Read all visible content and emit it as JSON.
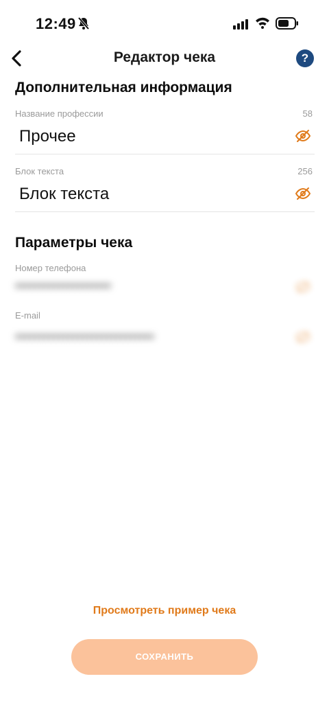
{
  "status_bar": {
    "time": "12:49"
  },
  "nav": {
    "title": "Редактор чека",
    "help_label": "?"
  },
  "additional_info": {
    "title": "Дополнительная информация",
    "fields": [
      {
        "label": "Название профессии",
        "count": "58",
        "value": "Прочее"
      },
      {
        "label": "Блок текста",
        "count": "256",
        "value": "Блок текста"
      }
    ]
  },
  "receipt_params": {
    "title": "Параметры чека",
    "fields": [
      {
        "label": "Номер телефона"
      },
      {
        "label": "E-mail"
      }
    ]
  },
  "actions": {
    "preview_label": "Просмотреть пример чека",
    "save_label": "СОХРАНИТЬ"
  },
  "colors": {
    "accent": "#e07a1a",
    "save_button_bg": "#fbc29b",
    "help_bg": "#1e4a80"
  },
  "icons": [
    "bell-slash-icon",
    "signal-icon",
    "wifi-icon",
    "battery-icon",
    "back-chevron-icon",
    "help-icon",
    "eye-off-icon"
  ]
}
